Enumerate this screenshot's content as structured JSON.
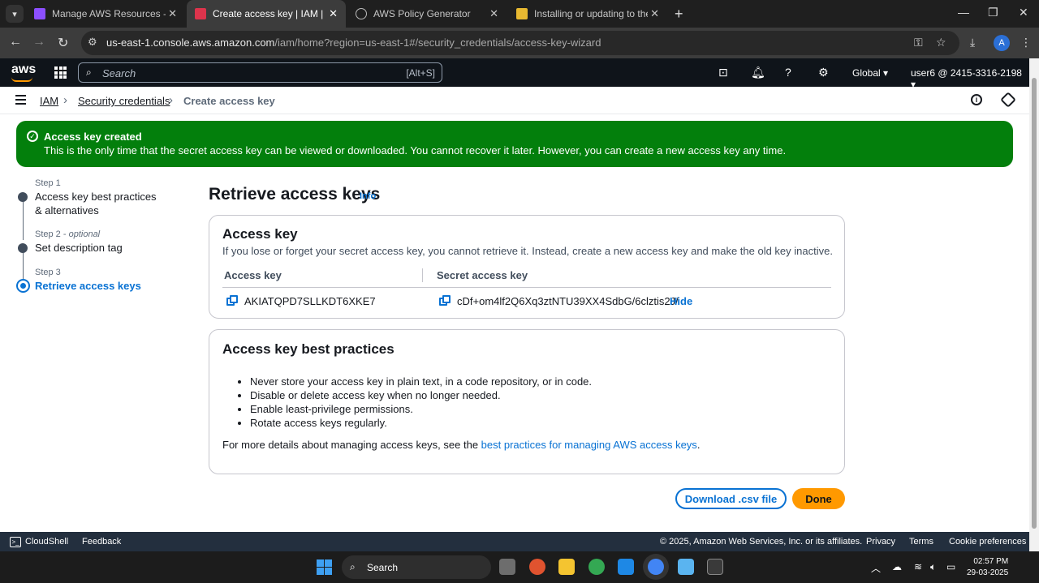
{
  "browser": {
    "tabs": [
      {
        "title": "Manage AWS Resources - AWS",
        "icon": "aws-cube-icon",
        "active": false
      },
      {
        "title": "Create access key | IAM | Global",
        "icon": "iam-icon",
        "active": true
      },
      {
        "title": "AWS Policy Generator",
        "icon": "globe-icon",
        "active": false
      },
      {
        "title": "Installing or updating to the lat",
        "icon": "package-icon",
        "active": false
      }
    ],
    "url_host": "us-east-1.console.aws.amazon.com",
    "url_path": "/iam/home?region=us-east-1#/security_credentials/access-key-wizard",
    "profile_initial": "A"
  },
  "aws_nav": {
    "logo": "aws",
    "search_placeholder": "Search",
    "search_shortcut": "[Alt+S]",
    "region": "Global",
    "account": "user6 @ 2415-3316-2198"
  },
  "breadcrumb": {
    "items": [
      "IAM",
      "Security credentials"
    ],
    "current": "Create access key"
  },
  "flash": {
    "title": "Access key created",
    "message": "This is the only time that the secret access key can be viewed or downloaded. You cannot recover it later. However, you can create a new access key any time."
  },
  "steps": [
    {
      "label": "Step 1",
      "optional": "",
      "title": "Access key best practices & alternatives"
    },
    {
      "label": "Step 2",
      "optional": "optional",
      "title": "Set description tag"
    },
    {
      "label": "Step 3",
      "optional": "",
      "title": "Retrieve access keys"
    }
  ],
  "page": {
    "title": "Retrieve access keys",
    "info_link": "Info"
  },
  "access_key_card": {
    "heading": "Access key",
    "description": "If you lose or forget your secret access key, you cannot retrieve it. Instead, create a new access key and make the old key inactive.",
    "col_access_key": "Access key",
    "col_secret_key": "Secret access key",
    "access_key_value": "AKIATQPD7SLLKDT6XKE7",
    "secret_key_value": "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",
    "hide_label": "Hide"
  },
  "best_practices_card": {
    "heading": "Access key best practices",
    "items": [
      "Never store your access key in plain text, in a code repository, or in code.",
      "Disable or delete access key when no longer needed.",
      "Enable least-privilege permissions.",
      "Rotate access keys regularly."
    ],
    "more_prefix": "For more details about managing access keys, see the ",
    "more_link": "best practices for managing AWS access keys",
    "more_suffix": "."
  },
  "actions": {
    "download_csv": "Download .csv file",
    "done": "Done"
  },
  "footer": {
    "cloudshell": "CloudShell",
    "feedback": "Feedback",
    "copyright": "© 2025, Amazon Web Services, Inc. or its affiliates.",
    "privacy": "Privacy",
    "terms": "Terms",
    "cookies": "Cookie preferences"
  },
  "taskbar": {
    "search_label": "Search",
    "time": "02:57 PM",
    "date": "29-03-2025"
  },
  "colors": {
    "aws_nav_bg": "#0f141a",
    "link_blue": "#0972d3",
    "success_green": "#037f0c",
    "primary_orange": "#ff9900"
  }
}
